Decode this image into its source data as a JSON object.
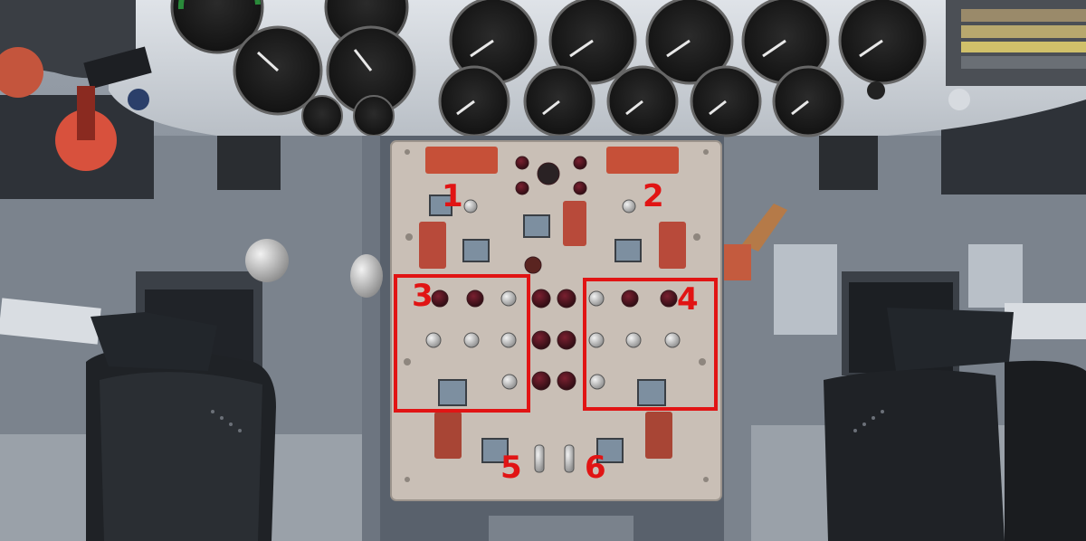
{
  "scene": {
    "description_visible_text": true,
    "callouts": [
      {
        "id": "1",
        "label": "1"
      },
      {
        "id": "2",
        "label": "2"
      },
      {
        "id": "3",
        "label": "3"
      },
      {
        "id": "4",
        "label": "4"
      },
      {
        "id": "5",
        "label": "5"
      },
      {
        "id": "6",
        "label": "6"
      }
    ]
  },
  "colors": {
    "highlight": "#e11414",
    "panel": "#c9bfb6",
    "cockpit_metal": "#8a929c",
    "gauge_face": "#1b1b1b",
    "cover_red": "#b84a3a"
  },
  "icons": [
    "analog-gauge-icon",
    "guarded-switch-icon",
    "toggle-switch-icon",
    "indicator-lamp-icon",
    "push-button-icon"
  ]
}
